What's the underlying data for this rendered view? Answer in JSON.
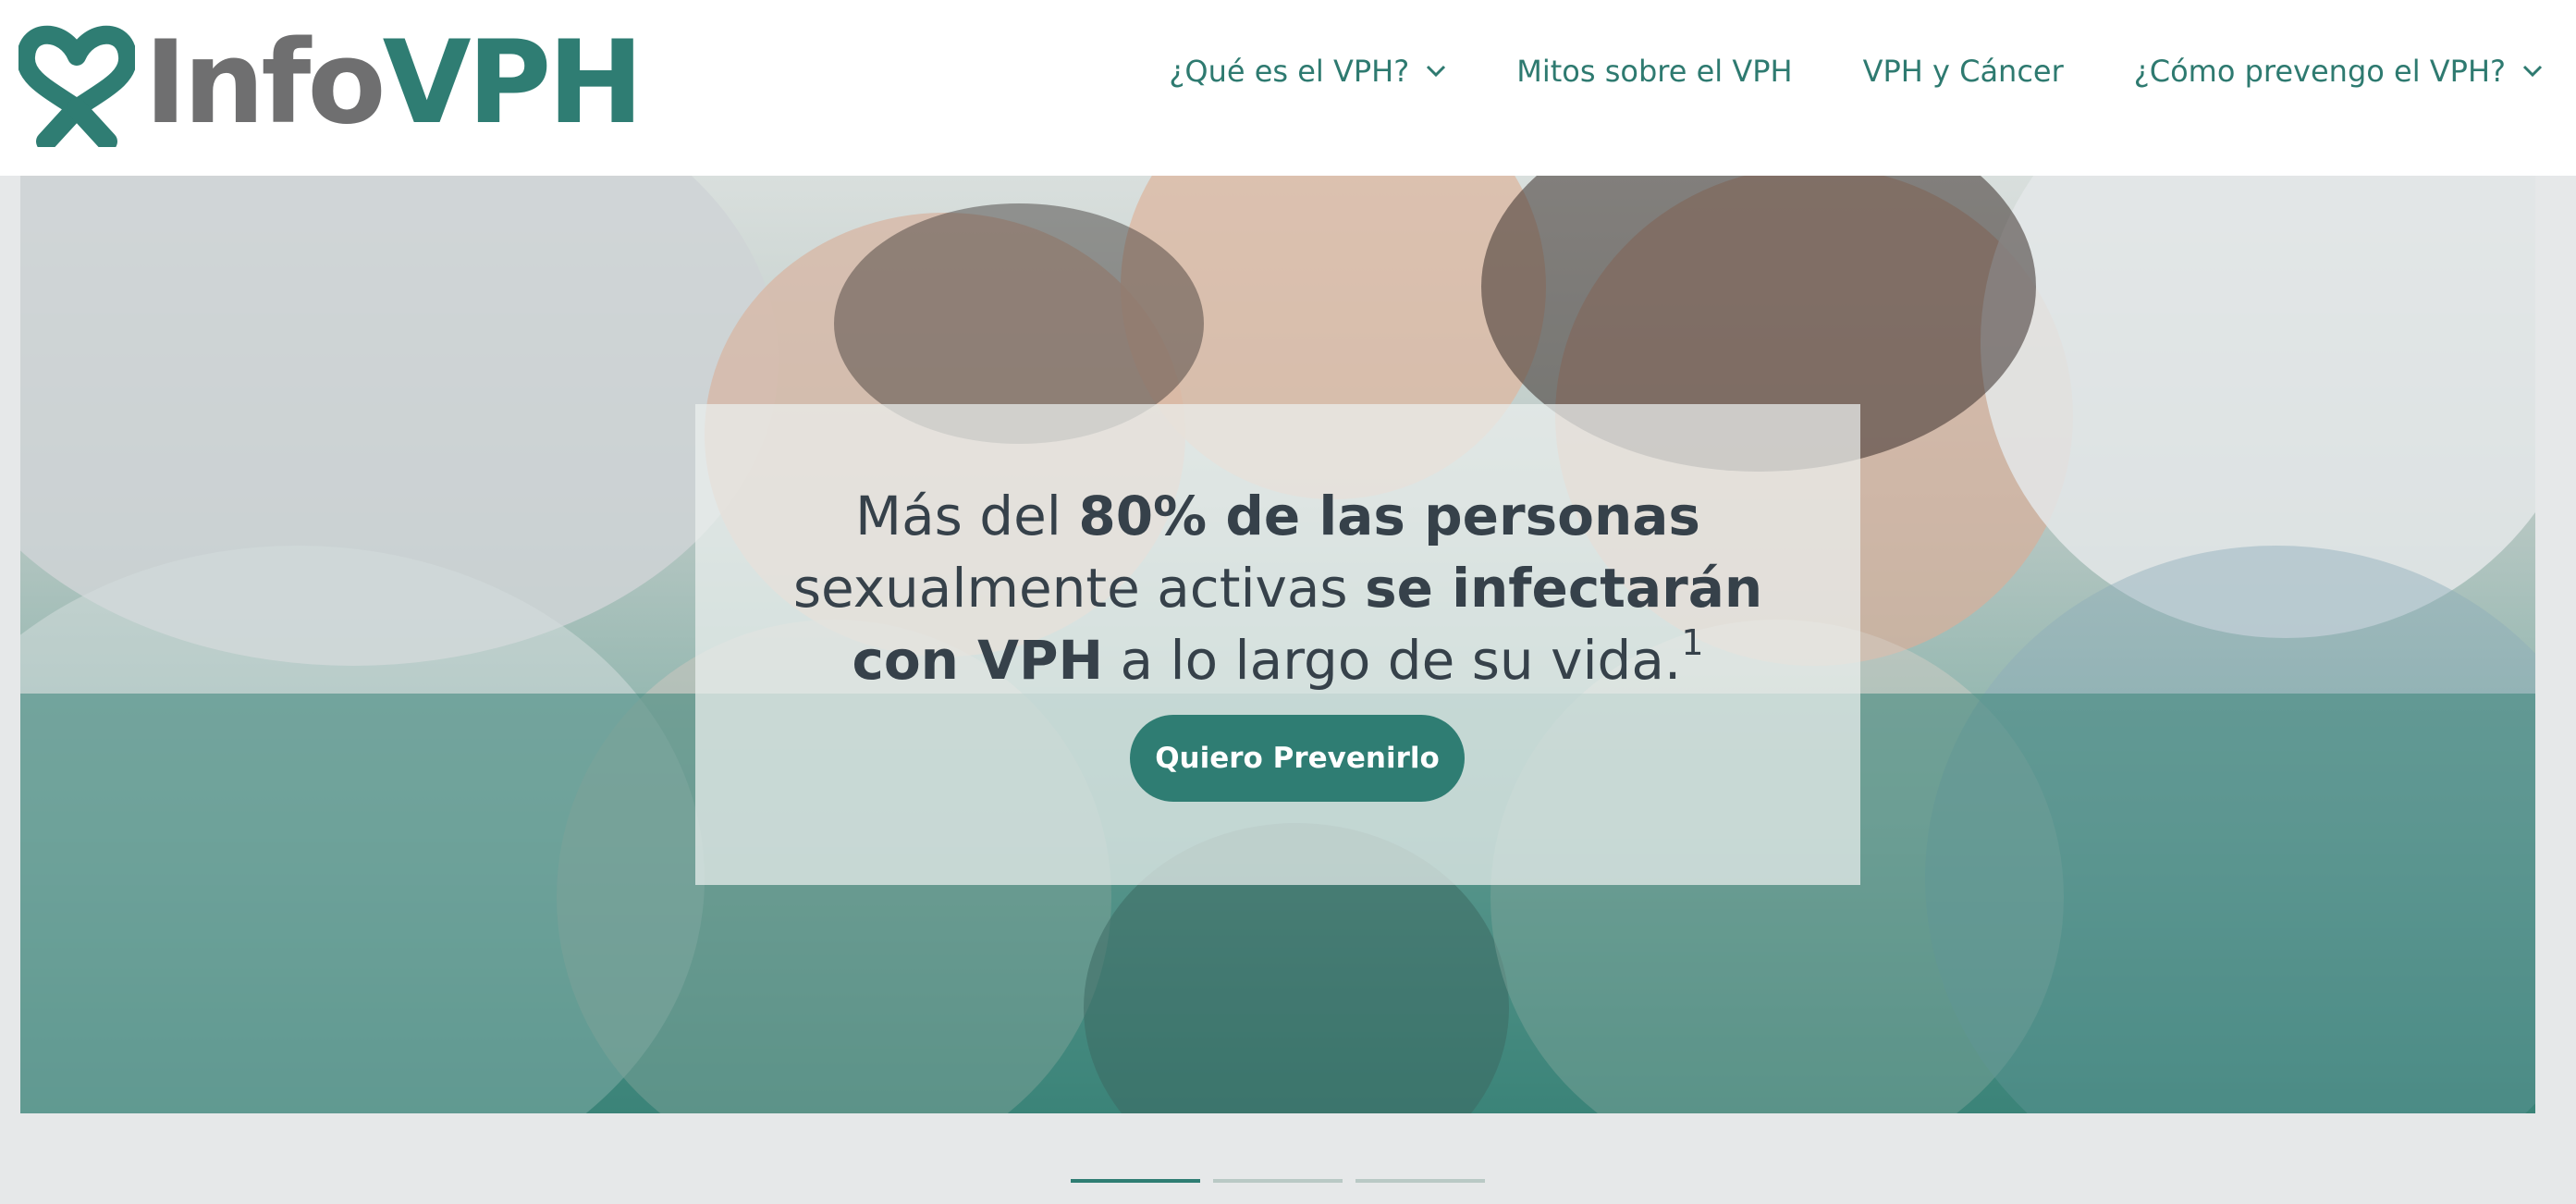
{
  "header": {
    "logo": {
      "text_prefix": "Info",
      "text_accent": "VPH"
    },
    "nav": [
      {
        "label": "¿Qué es el VPH?",
        "has_dropdown": true
      },
      {
        "label": "Mitos sobre el VPH",
        "has_dropdown": false
      },
      {
        "label": "VPH y Cáncer",
        "has_dropdown": false
      },
      {
        "label": "¿Cómo prevengo el VPH?",
        "has_dropdown": true
      }
    ]
  },
  "hero": {
    "headline": {
      "part1": "Más del ",
      "part2_bold": "80% de las personas",
      "part3": " sexualmente activas ",
      "part4_bold": "se infectarán con VPH",
      "part5": " a lo largo de su vida.",
      "footnote": "1"
    },
    "cta_label": "Quiero Prevenirlo"
  },
  "carousel": {
    "slides": 3,
    "active_index": 0
  },
  "colors": {
    "brand_teal": "#2f7d73",
    "logo_gray": "#6f6f70",
    "headline_text": "#36414a",
    "page_background": "#e6e8e9"
  }
}
